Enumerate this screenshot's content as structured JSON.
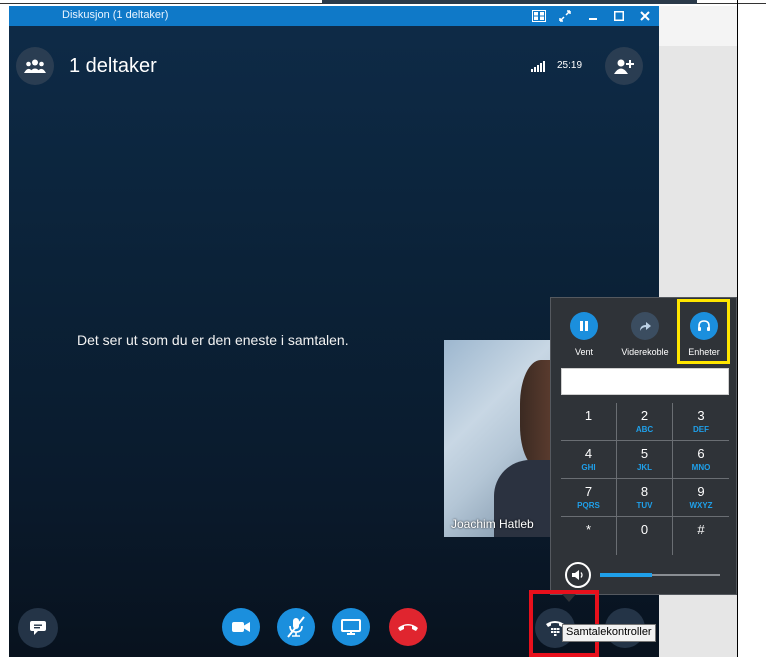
{
  "window": {
    "title": "Diskusjon (1 deltaker)"
  },
  "header": {
    "participants_label": "1 deltaker",
    "call_timer": "25:19"
  },
  "stage": {
    "alone_message": "Det ser ut som du er den eneste i samtalen.",
    "video_tile_name": "Joachim Hatleb"
  },
  "call_controls": {
    "hold_label": "Vent",
    "transfer_label": "Viderekoble",
    "devices_label": "Enheter",
    "dialpad_value": "",
    "keys": [
      {
        "digit": "1",
        "letters": ""
      },
      {
        "digit": "2",
        "letters": "ABC"
      },
      {
        "digit": "3",
        "letters": "DEF"
      },
      {
        "digit": "4",
        "letters": "GHI"
      },
      {
        "digit": "5",
        "letters": "JKL"
      },
      {
        "digit": "6",
        "letters": "MNO"
      },
      {
        "digit": "7",
        "letters": "PQRS"
      },
      {
        "digit": "8",
        "letters": "TUV"
      },
      {
        "digit": "9",
        "letters": "WXYZ"
      },
      {
        "digit": "*",
        "letters": ""
      },
      {
        "digit": "0",
        "letters": ""
      },
      {
        "digit": "#",
        "letters": ""
      }
    ],
    "volume_level": 0.43
  },
  "tooltip": {
    "text": "Samtalekontroller"
  },
  "colors": {
    "titlebar": "#0f79c8",
    "accent_blue": "#1b8fdd",
    "hangup_red": "#e0252f",
    "highlight_yellow": "#ffe600",
    "highlight_red": "#e8101c"
  },
  "icons": {
    "participants": "people-icon",
    "add_person": "add-person-icon",
    "chat": "chat-bubble-icon",
    "video": "video-camera-icon",
    "mute": "microphone-muted-icon",
    "share": "screen-share-icon",
    "hangup": "hangup-icon",
    "call_controls": "phone-keypad-icon",
    "more": "more-icon",
    "hold": "pause-icon",
    "transfer": "transfer-icon",
    "devices": "headset-icon",
    "volume": "speaker-icon",
    "signal": "signal-bars-icon"
  }
}
